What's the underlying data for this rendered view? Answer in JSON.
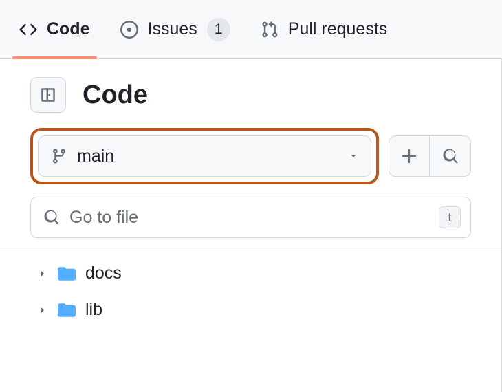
{
  "tabs": {
    "code": {
      "label": "Code"
    },
    "issues": {
      "label": "Issues",
      "count": "1"
    },
    "pulls": {
      "label": "Pull requests"
    }
  },
  "header": {
    "title": "Code"
  },
  "branch": {
    "name": "main"
  },
  "search": {
    "placeholder": "Go to file",
    "shortcut": "t"
  },
  "tree": {
    "items": [
      {
        "name": "docs"
      },
      {
        "name": "lib"
      }
    ]
  }
}
